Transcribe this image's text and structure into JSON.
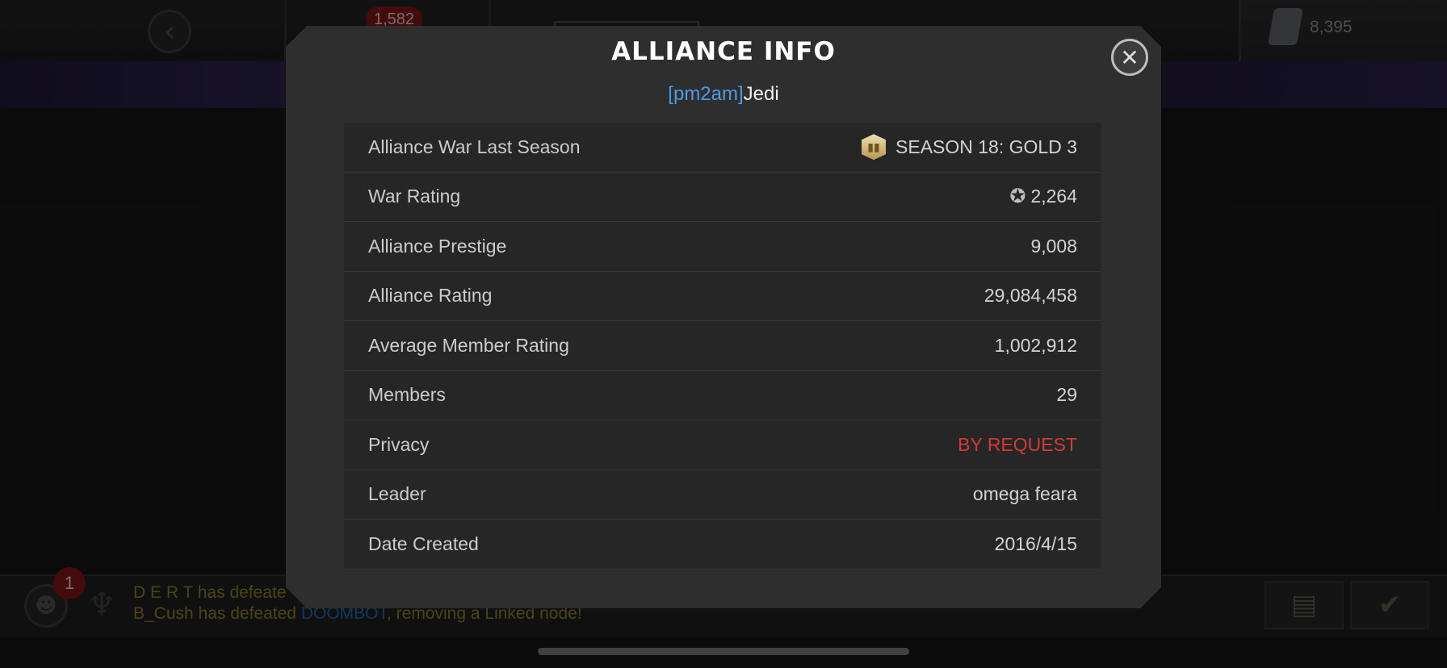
{
  "background": {
    "currency_count": "1,582",
    "units_count": "8,395",
    "notification_count": "1",
    "feed": [
      {
        "pre": "D E R T has defeate",
        "highlight": "",
        "post": ""
      },
      {
        "pre": "B_Cush has defeated ",
        "highlight": "DOOMBOT",
        "post": ", removing a Linked node!"
      }
    ]
  },
  "modal": {
    "title": "ALLIANCE INFO",
    "alliance_tag": "[pm2am]",
    "alliance_name": "Jedi",
    "rows": [
      {
        "label": "Alliance War Last Season",
        "value": "SEASON 18: GOLD 3",
        "icon": "season-gold-icon"
      },
      {
        "label": "War Rating",
        "value": "2,264",
        "icon": "war-rating-icon"
      },
      {
        "label": "Alliance Prestige",
        "value": "9,008"
      },
      {
        "label": "Alliance Rating",
        "value": "29,084,458"
      },
      {
        "label": "Average Member Rating",
        "value": "1,002,912"
      },
      {
        "label": "Members",
        "value": "29"
      },
      {
        "label": "Privacy",
        "value": "BY REQUEST"
      },
      {
        "label": "Leader",
        "value": "omega feara"
      },
      {
        "label": "Date Created",
        "value": "2016/4/15"
      }
    ]
  },
  "colors": {
    "alliance_tag": "#4e9ae4",
    "privacy_value": "#d23a3a",
    "feed_text": "#8a7a26",
    "feed_highlight": "#2266a8"
  }
}
